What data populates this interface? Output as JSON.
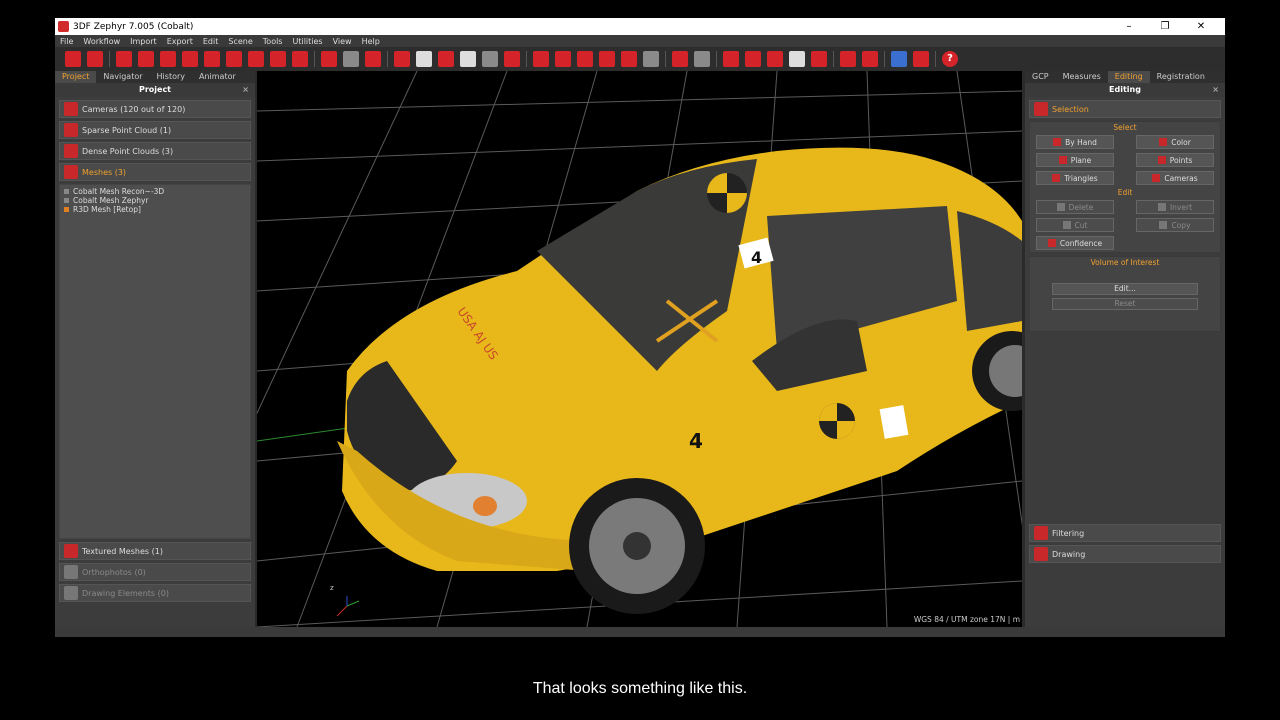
{
  "window": {
    "title": "3DF Zephyr 7.005 (Cobalt)",
    "minimize": "–",
    "restore": "❐",
    "close": "✕"
  },
  "menu": [
    "File",
    "Workflow",
    "Import",
    "Export",
    "Edit",
    "Scene",
    "Tools",
    "Utilities",
    "View",
    "Help"
  ],
  "left_panel": {
    "tabs": [
      "Project",
      "Navigator",
      "History",
      "Animator"
    ],
    "active_tab": "Project",
    "title": "Project",
    "close": "×",
    "sections": {
      "cameras": "Cameras (120 out of 120)",
      "sparse": "Sparse Point Cloud (1)",
      "dense": "Dense Point Clouds (3)",
      "meshes": "Meshes (3)",
      "textured": "Textured Meshes (1)",
      "ortho": "Orthophotos (0)",
      "drawing": "Drawing Elements (0)"
    },
    "mesh_items": [
      "Cobalt Mesh Recon~-3D",
      "Cobalt Mesh Zephyr",
      "R3D Mesh [Retop]"
    ]
  },
  "right_panel": {
    "tabs": [
      "GCP",
      "Measures",
      "Editing",
      "Registration"
    ],
    "active_tab": "Editing",
    "title": "Editing",
    "close": "×",
    "selection": "Selection",
    "select_caption": "Select",
    "select_buttons": [
      "By Hand",
      "Color",
      "Plane",
      "Points",
      "Triangles",
      "Cameras"
    ],
    "edit_caption": "Edit",
    "edit_buttons": [
      "Delete",
      "Invert",
      "Cut",
      "Copy",
      "Confidence"
    ],
    "voi_caption": "Volume of Interest",
    "voi_edit": "Edit...",
    "voi_reset": "Reset",
    "filtering": "Filtering",
    "drawing": "Drawing"
  },
  "viewport": {
    "coords": "WGS 84 / UTM zone 17N | m",
    "axis_z": "z",
    "badge_front": "4",
    "badge_side": "4",
    "hood_text": "USA AJ US"
  },
  "subtitle": "That looks something like this."
}
